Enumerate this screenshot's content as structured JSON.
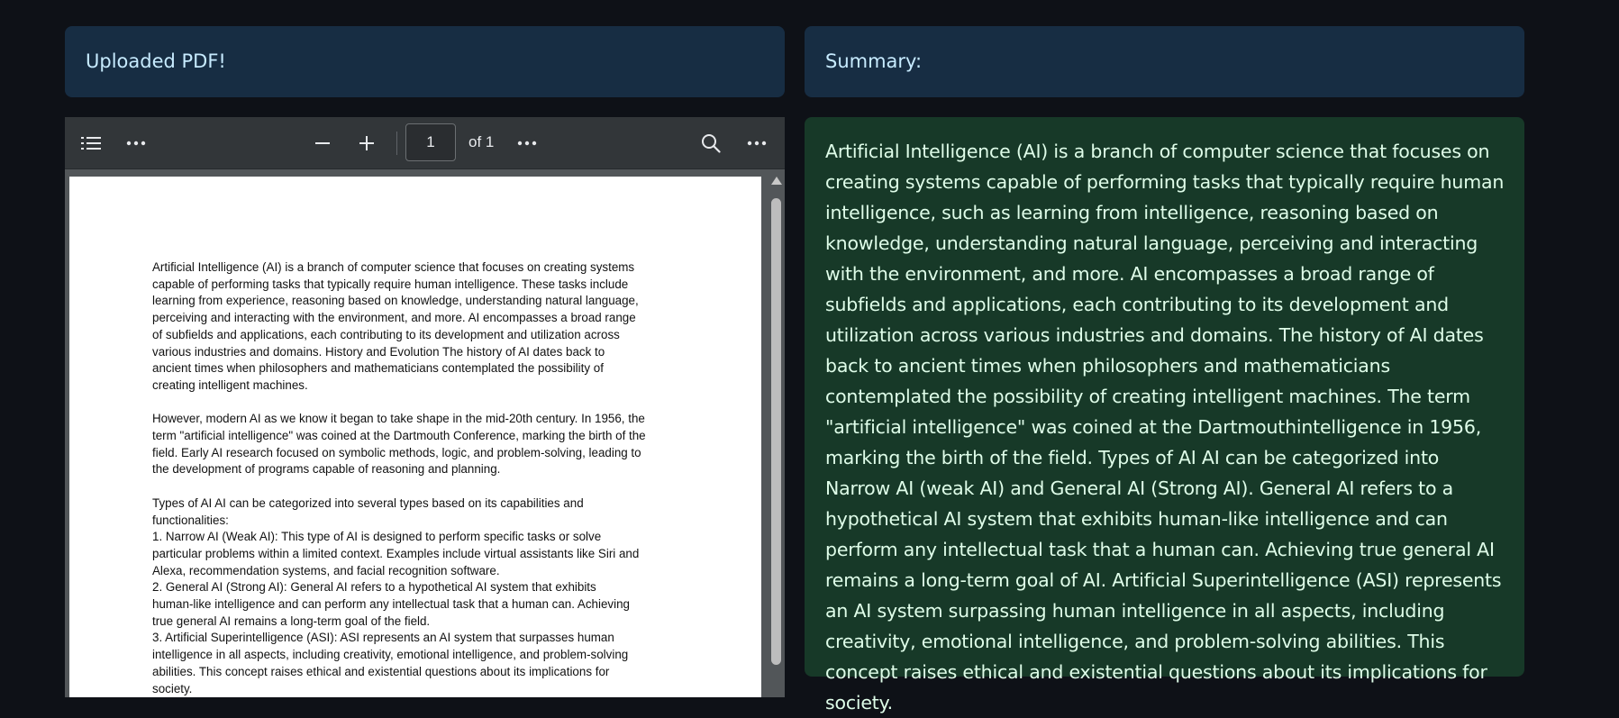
{
  "left_banner": {
    "text": "Uploaded PDF!"
  },
  "right_banner": {
    "text": "Summary:"
  },
  "pdf_viewer": {
    "toolbar": {
      "outline_icon": "list-icon",
      "more_icon": "more-horizontal-icon",
      "zoom_out_icon": "minus-icon",
      "zoom_in_icon": "plus-icon",
      "page_value": "1",
      "page_total": "of 1",
      "search_icon": "search-icon"
    },
    "page_paragraphs": [
      "Artificial Intelligence (AI) is a branch of computer science that focuses on creating systems\ncapable of performing tasks that typically require human intelligence. These tasks include\nlearning from experience, reasoning based on knowledge, understanding natural language,\nperceiving and interacting with the environment, and more. AI encompasses a broad range\nof subfields and applications, each contributing to its development and utilization across\nvarious industries and domains. History and Evolution The history of AI dates back to\nancient times when philosophers and mathematicians contemplated the possibility of\ncreating intelligent machines.",
      "However, modern AI as we know it began to take shape in the mid-20th century. In 1956, the\nterm \"artificial intelligence\" was coined at the Dartmouth Conference, marking the birth of the\nfield. Early AI research focused on symbolic methods, logic, and problem-solving, leading to\nthe development of programs capable of reasoning and planning.",
      "Types of AI AI can be categorized into several types based on its capabilities and\nfunctionalities:\n1. Narrow AI (Weak AI): This type of AI is designed to perform specific tasks or solve\nparticular problems within a limited context. Examples include virtual assistants like Siri and\nAlexa, recommendation systems, and facial recognition software.\n 2. General AI (Strong AI): General AI refers to a hypothetical AI system that exhibits\nhuman-like intelligence and can perform any intellectual task that a human can. Achieving\ntrue general AI remains a long-term goal of the field.\n 3. Artificial Superintelligence (ASI): ASI represents an AI system that surpasses human\nintelligence in all aspects, including creativity, emotional intelligence, and problem-solving\nabilities. This concept raises ethical and existential questions about its implications for\nsociety."
    ]
  },
  "summary": {
    "text": "Artificial Intelligence (AI) is a branch of computer science that focuses on creating systems capable of performing tasks that typically require human intelligence, such as learning from intelligence, reasoning based on knowledge, understanding natural language, perceiving and interacting with the environment, and more. AI encompasses a broad range of subfields and applications, each contributing to its development and utilization across various industries and domains. The history of AI dates back to ancient times when philosophers and mathematicians contemplated the possibility of creating intelligent machines. The term \"artificial intelligence\" was coined at the Dartmouthintelligence in 1956, marking the birth of the field. Types of AI AI can be categorized into Narrow AI (weak AI) and General AI (Strong AI). General AI refers to a hypothetical AI system that exhibits human-like intelligence and can perform any intellectual task that a human can. Achieving true general AI remains a long-term goal of AI. Artificial Superintelligence (ASI) represents an AI system surpassing human intelligence in all aspects, including creativity, emotional intelligence, and problem-solving abilities. This concept raises ethical and existential questions about its implications for society."
  },
  "colors": {
    "background": "#0e1117",
    "info_banner": "#172d43",
    "info_text": "#c7ebff",
    "success_box": "#173928",
    "success_text": "#dffde9"
  }
}
